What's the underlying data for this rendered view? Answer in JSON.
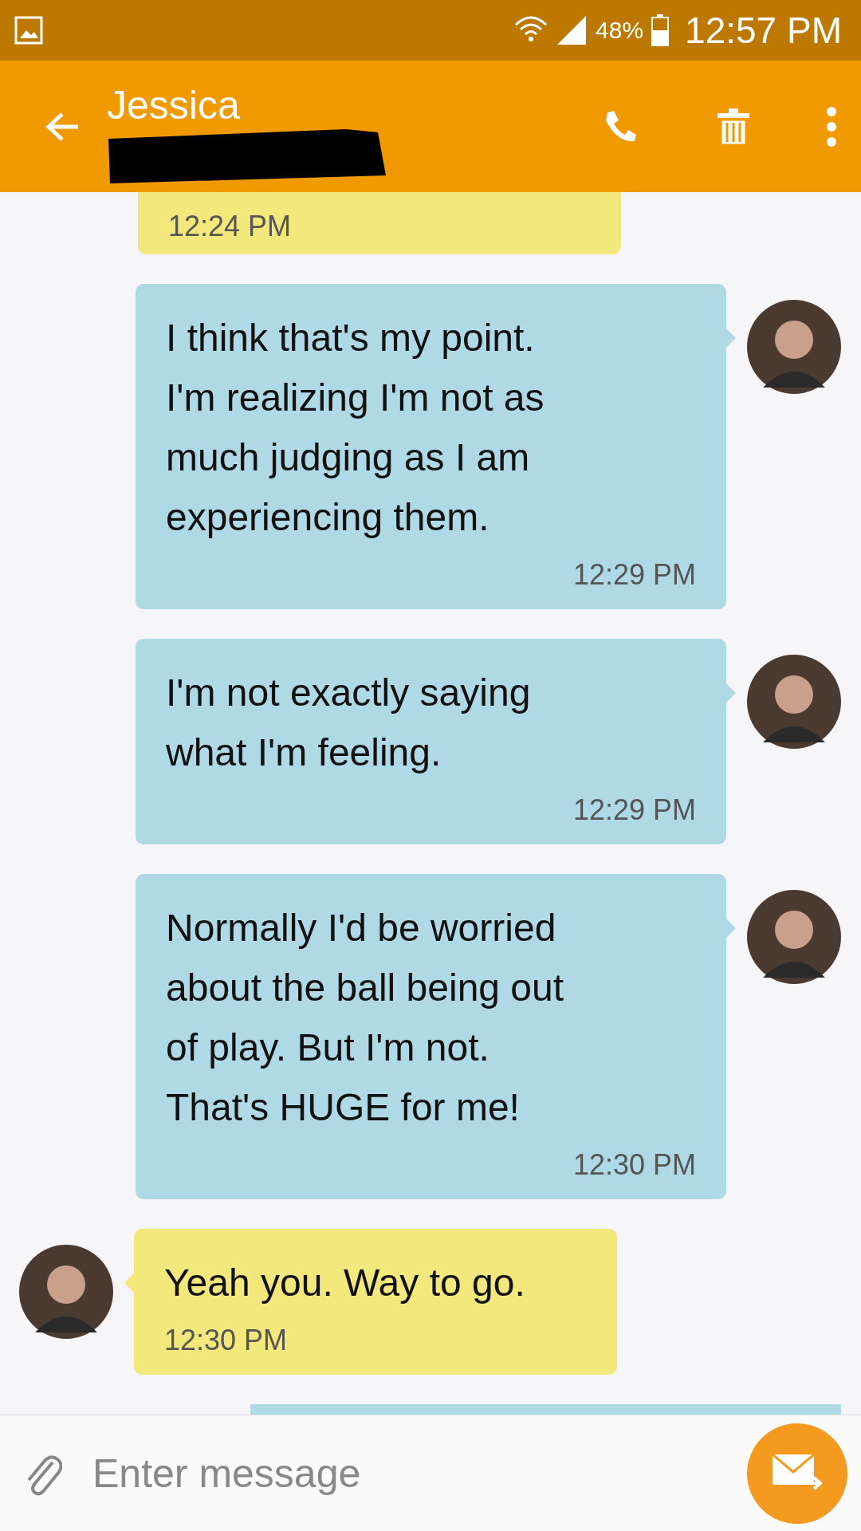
{
  "status_bar": {
    "battery": "48%",
    "time": "12:57 PM"
  },
  "toolbar": {
    "title": "Jessica"
  },
  "input": {
    "placeholder": "Enter message"
  },
  "messages": [
    {
      "kind": "received",
      "time": "12:24 PM"
    },
    {
      "kind": "sent",
      "text": "I think that's my point.\nI'm realizing I'm not as\nmuch judging as I am\nexperiencing them.",
      "time": "12:29 PM"
    },
    {
      "kind": "sent",
      "text": "I'm not exactly saying\nwhat I'm feeling.",
      "time": "12:29 PM"
    },
    {
      "kind": "sent",
      "text": "Normally I'd be worried\nabout the ball being out\nof play. But I'm not.\nThat's HUGE for me!",
      "time": "12:30 PM"
    },
    {
      "kind": "received",
      "text": "Yeah you. Way to go.",
      "time": "12:30 PM"
    },
    {
      "kind": "sent"
    }
  ]
}
